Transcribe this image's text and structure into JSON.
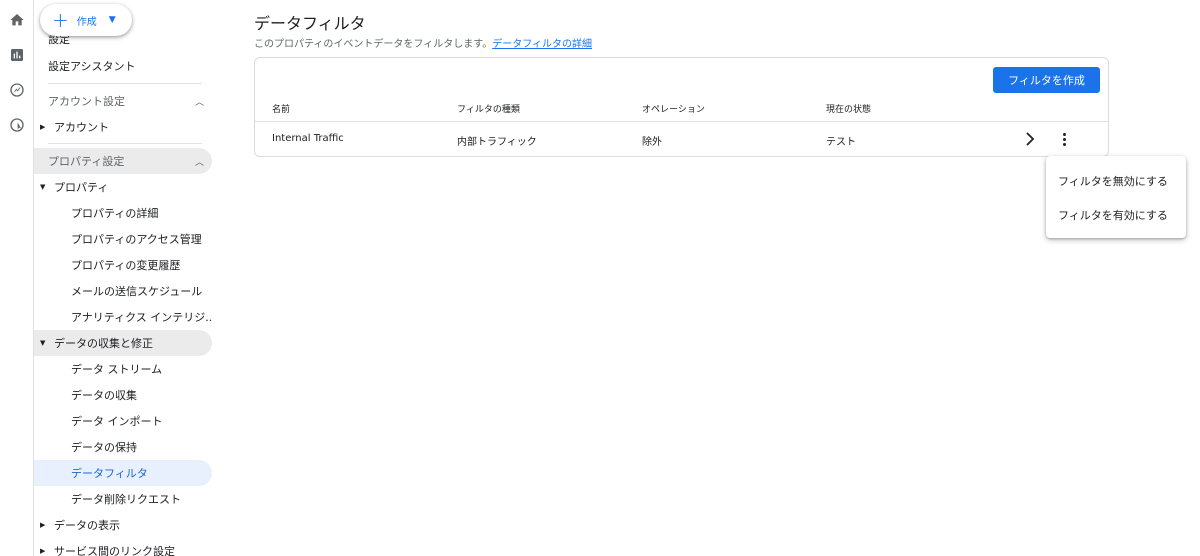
{
  "rail": {
    "icons": [
      "home-icon",
      "reports-icon",
      "explore-icon",
      "advertising-icon"
    ]
  },
  "create": {
    "label": "作成"
  },
  "sidebar": {
    "partial_top": "設定",
    "setup_assistant": "設定アシスタント",
    "account_section": "アカウント設定",
    "account": "アカウント",
    "property_section": "プロパティ設定",
    "property": "プロパティ",
    "property_items": [
      "プロパティの詳細",
      "プロパティのアクセス管理",
      "プロパティの変更履歴",
      "メールの送信スケジュール",
      "アナリティクス インテリジ..."
    ],
    "data_collection": "データの収集と修正",
    "data_items": [
      "データ ストリーム",
      "データの収集",
      "データ インポート",
      "データの保持",
      "データフィルタ",
      "データ削除リクエスト"
    ],
    "data_display": "データの表示",
    "service_links": "サービス間のリンク設定"
  },
  "page": {
    "title": "データフィルタ",
    "subtitle": "このプロパティのイベントデータをフィルタします。",
    "subtitle_link": "データフィルタの詳細"
  },
  "table": {
    "create_button": "フィルタを作成",
    "headers": [
      "名前",
      "フィルタの種類",
      "オペレーション",
      "現在の状態"
    ],
    "rows": [
      {
        "name": "Internal Traffic",
        "type": "内部トラフィック",
        "operation": "除外",
        "status": "テスト"
      }
    ]
  },
  "menu": {
    "items": [
      "フィルタを無効にする",
      "フィルタを有効にする"
    ]
  },
  "colors": {
    "accent": "#1a73e8",
    "selected_bg": "#e8f0fe"
  }
}
